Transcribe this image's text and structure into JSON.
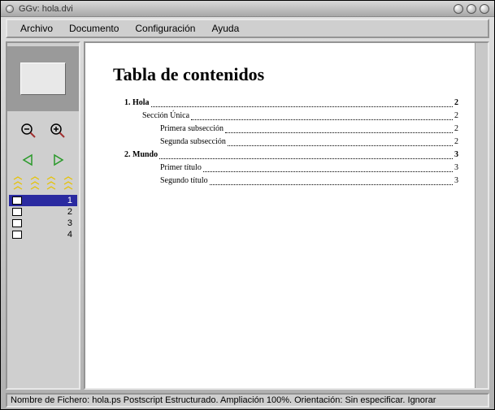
{
  "window": {
    "title": "GGv: hola.dvi"
  },
  "menu": {
    "file": "Archivo",
    "document": "Documento",
    "config": "Configuración",
    "help": "Ayuda"
  },
  "sidebar": {
    "pages": [
      {
        "num": "1",
        "selected": true
      },
      {
        "num": "2",
        "selected": false
      },
      {
        "num": "3",
        "selected": false
      },
      {
        "num": "4",
        "selected": false
      }
    ]
  },
  "doc": {
    "heading": "Tabla de contenidos",
    "toc": [
      {
        "indent": 1,
        "bold": true,
        "label": "1. Hola",
        "page": "2"
      },
      {
        "indent": 2,
        "bold": false,
        "label": "Sección Única",
        "page": "2"
      },
      {
        "indent": 3,
        "bold": false,
        "label": "Primera subsección",
        "page": "2"
      },
      {
        "indent": 3,
        "bold": false,
        "label": "Segunda subsección",
        "page": "2"
      },
      {
        "indent": 1,
        "bold": true,
        "label": "2. Mundo",
        "page": "3"
      },
      {
        "indent": 3,
        "bold": false,
        "label": "Primer título",
        "page": "3"
      },
      {
        "indent": 3,
        "bold": false,
        "label": "Segundo título",
        "page": "3"
      }
    ]
  },
  "status": {
    "text": "Nombre de Fichero: hola.ps Postscript Estructurado. Ampliación 100%. Orientación: Sin especificar. Ignorar"
  },
  "colors": {
    "selection": "#2a2aa0",
    "mark_yellow": "#e6c200",
    "nav_green": "#2a9a2a"
  }
}
